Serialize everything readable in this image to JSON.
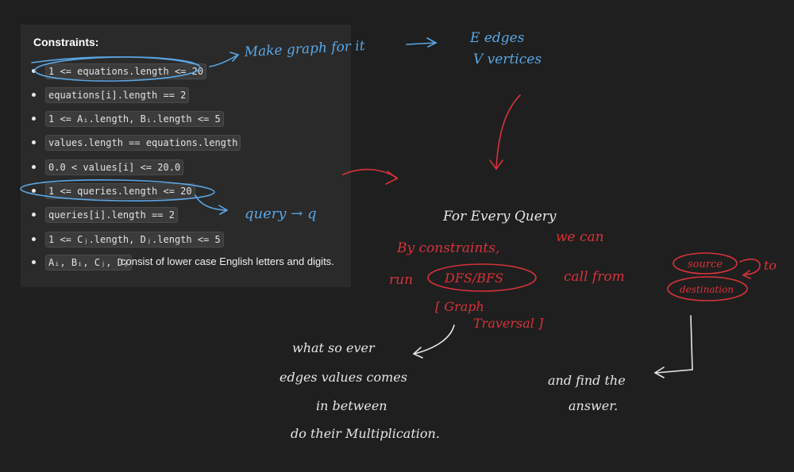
{
  "constraints": {
    "title": "Constraints:",
    "items": [
      {
        "code": "1 <= equations.length <= 20"
      },
      {
        "code": "equations[i].length == 2"
      },
      {
        "code": "1 <= Aᵢ.length, Bᵢ.length <= 5"
      },
      {
        "code": "values.length == equations.length"
      },
      {
        "code": "0.0 < values[i] <= 20.0"
      },
      {
        "code": "1 <= queries.length <= 20"
      },
      {
        "code": "queries[i].length == 2"
      },
      {
        "code": "1 <= Cⱼ.length, Dⱼ.length <= 5"
      },
      {
        "code": "Aᵢ, Bᵢ, Cⱼ, Dⱼ",
        "text": "consist of lower case English letters and digits."
      }
    ]
  },
  "annotations": {
    "make_graph": "Make graph for it",
    "e_edges": "E   edges",
    "v_vertices": "V   vertices",
    "query_q": "query → q",
    "for_every_query": "For Every Query",
    "by_constraints": "By  constraints,",
    "we_can": "we  can",
    "run": "run",
    "dfs_bfs": "DFS/BFS",
    "call_from": "call   from",
    "source": "source",
    "to": "to",
    "destination": "destination",
    "graph_traversal_1": "[ Graph",
    "graph_traversal_2": "Traversal ]",
    "whatsoever_1": "what  so  ever",
    "whatsoever_2": "edges  values  comes",
    "whatsoever_3": "in  between",
    "whatsoever_4": "do   their   Multiplication.",
    "find_1": "and   find   the",
    "find_2": "answer."
  },
  "colors": {
    "background": "#1f1f1f",
    "panel": "#2a2a2a",
    "blue_ink": "#5aa6e6",
    "red_ink": "#d8323a",
    "white_ink": "#e6e6e6"
  }
}
